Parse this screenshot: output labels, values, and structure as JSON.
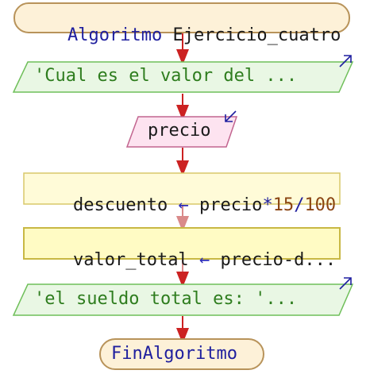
{
  "colors": {
    "terminal_fill": "#fdf1d8",
    "terminal_stroke": "#b8935a",
    "io_fill": "#e9f7e4",
    "io_stroke": "#6fbf5a",
    "input_fill": "#fde3f0",
    "input_stroke": "#c2658f",
    "process_fill": "#fffbd8",
    "process_stroke": "#d8c86a",
    "process2_fill": "#fffbc4",
    "process2_stroke": "#c8b844",
    "connector": "#cc2222",
    "connector_light": "#d98a8a",
    "io_arrow": "#1f1fa0"
  },
  "flow": {
    "start": {
      "keyword": "Algoritmo",
      "name": "Ejercicio_cuatro"
    },
    "output1": {
      "text": "'Cual es el valor del ...",
      "icon": "output-arrow-icon"
    },
    "input1": {
      "text": "precio",
      "icon": "input-arrow-icon"
    },
    "assign1": {
      "target": "descuento",
      "arrow": "←",
      "var": "precio",
      "op1": "*",
      "num1": "15",
      "op2": "/",
      "num2": "100"
    },
    "assign2": {
      "target": "valor_total",
      "arrow": "←",
      "expr": "precio-d..."
    },
    "output2": {
      "text": "'el sueldo total es: '...",
      "icon": "output-arrow-icon"
    },
    "end": {
      "keyword": "FinAlgoritmo"
    }
  }
}
